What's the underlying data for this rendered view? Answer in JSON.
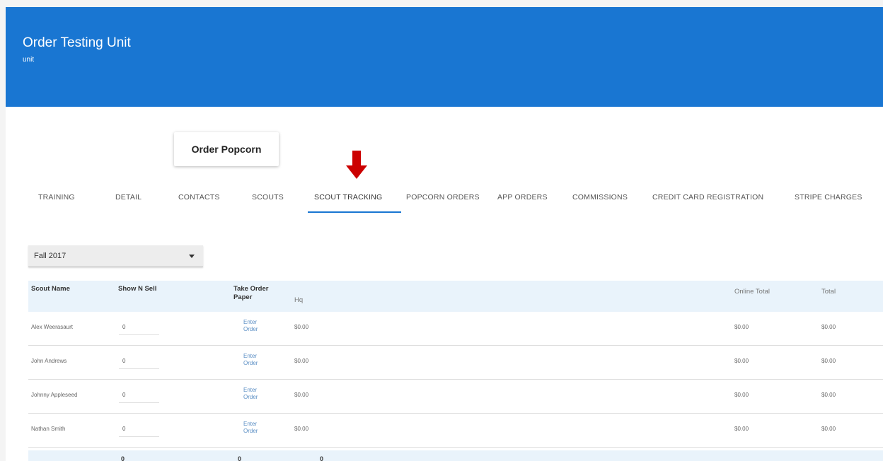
{
  "header": {
    "title": "Order Testing Unit",
    "subtitle": "unit"
  },
  "order_button_label": "Order Popcorn",
  "tabs": [
    {
      "label": "TRAINING"
    },
    {
      "label": "DETAIL"
    },
    {
      "label": "CONTACTS"
    },
    {
      "label": "SCOUTS"
    },
    {
      "label": "SCOUT TRACKING",
      "active": true
    },
    {
      "label": "POPCORN ORDERS"
    },
    {
      "label": "APP ORDERS"
    },
    {
      "label": "COMMISSIONS"
    },
    {
      "label": "CREDIT CARD REGISTRATION"
    },
    {
      "label": "STRIPE CHARGES"
    }
  ],
  "colors": {
    "header": "#1976d2",
    "accent": "#1976d2",
    "arrow": "#cc0000",
    "table_header_bg": "#e9f3fb",
    "link": "#5a8ec4"
  },
  "icons": {
    "annotation": "red-down-arrow",
    "select": "caret-down-icon"
  },
  "season_select": {
    "value": "Fall 2017"
  },
  "table": {
    "headers": {
      "scout_name": "Scout Name",
      "show_n_sell": "Show N Sell",
      "take_order_paper": "Take Order Paper",
      "hq": "Hq",
      "online_total": "Online Total",
      "total": "Total"
    },
    "rows": [
      {
        "name": "Alex Weerasaurt",
        "show_n_sell": "0",
        "link": "Enter Order",
        "hq": "$0.00",
        "online_total": "$0.00",
        "total": "$0.00"
      },
      {
        "name": "John Andrews",
        "show_n_sell": "0",
        "link": "Enter Order",
        "hq": "$0.00",
        "online_total": "$0.00",
        "total": "$0.00"
      },
      {
        "name": "Johnny Appleseed",
        "show_n_sell": "0",
        "link": "Enter Order",
        "hq": "$0.00",
        "online_total": "$0.00",
        "total": "$0.00"
      },
      {
        "name": "Nathan Smith",
        "show_n_sell": "0",
        "link": "Enter Order",
        "hq": "$0.00",
        "online_total": "$0.00",
        "total": "$0.00"
      }
    ],
    "footer": {
      "show_n_sell": "0",
      "take_order": "0",
      "hq": "0"
    }
  }
}
